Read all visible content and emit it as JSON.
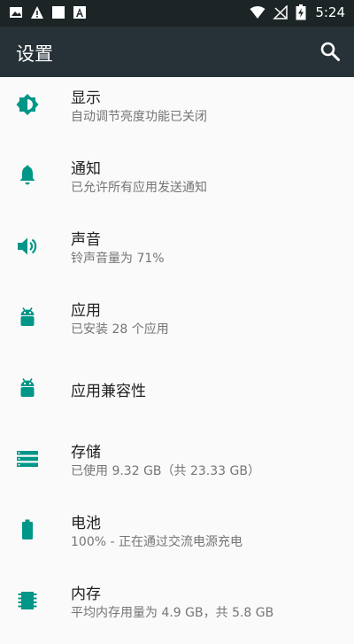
{
  "status_bar": {
    "time": "5:24",
    "left_icons": [
      "image-icon",
      "warning-icon",
      "stop-icon",
      "font-icon"
    ],
    "right_icons": [
      "wifi-icon",
      "no-signal-icon",
      "battery-charging-icon"
    ]
  },
  "appbar": {
    "title": "设置",
    "search_icon": "search-icon"
  },
  "colors": {
    "accent": "#009688",
    "appbar": "#263238",
    "statusbar": "#1c2426",
    "background": "#fafafa"
  },
  "items": [
    {
      "icon": "brightness-icon",
      "title": "显示",
      "subtitle": "自动调节亮度功能已关闭"
    },
    {
      "icon": "bell-icon",
      "title": "通知",
      "subtitle": "已允许所有应用发送通知"
    },
    {
      "icon": "volume-icon",
      "title": "声音",
      "subtitle": "铃声音量为 71%"
    },
    {
      "icon": "android-icon",
      "title": "应用",
      "subtitle": "已安装 28 个应用"
    },
    {
      "icon": "android-icon",
      "title": "应用兼容性",
      "subtitle": ""
    },
    {
      "icon": "storage-icon",
      "title": "存储",
      "subtitle": "已使用 9.32 GB（共 23.33 GB）"
    },
    {
      "icon": "battery-icon",
      "title": "电池",
      "subtitle": "100% - 正在通过交流电源充电"
    },
    {
      "icon": "memory-icon",
      "title": "内存",
      "subtitle": "平均内存用量为 4.9 GB，共 5.8 GB"
    }
  ]
}
